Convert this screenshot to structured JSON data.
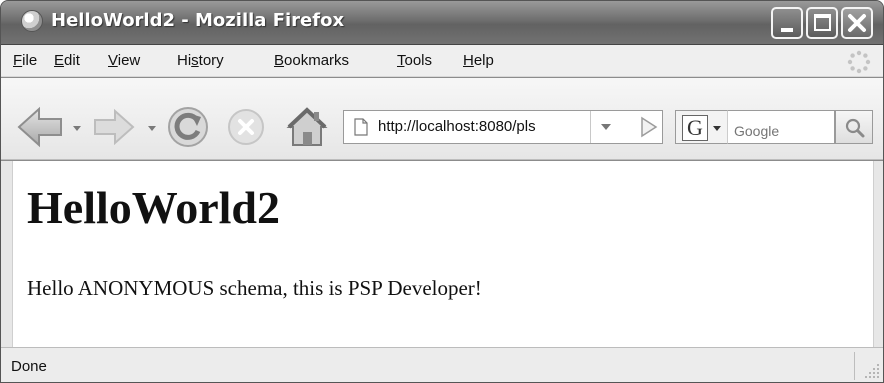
{
  "window": {
    "title": "HelloWorld2 - Mozilla Firefox"
  },
  "menubar": {
    "items": [
      {
        "label": "File",
        "accesskey": "F",
        "rest": "ile"
      },
      {
        "label": "Edit",
        "accesskey": "E",
        "rest": "dit"
      },
      {
        "label": "View",
        "accesskey": "V",
        "rest": "iew"
      },
      {
        "label": "History",
        "pre": "Hi",
        "accesskey": "s",
        "rest": "tory"
      },
      {
        "label": "Bookmarks",
        "accesskey": "B",
        "rest": "ookmarks"
      },
      {
        "label": "Tools",
        "accesskey": "T",
        "rest": "ools"
      },
      {
        "label": "Help",
        "accesskey": "H",
        "rest": "elp"
      }
    ]
  },
  "toolbar": {
    "url": "http://localhost:8080/pls",
    "search_engine_letter": "G",
    "search_placeholder": "Google"
  },
  "content": {
    "heading": "HelloWorld2",
    "text": "Hello ANONYMOUS schema, this is PSP Developer!"
  },
  "statusbar": {
    "text": "Done"
  }
}
